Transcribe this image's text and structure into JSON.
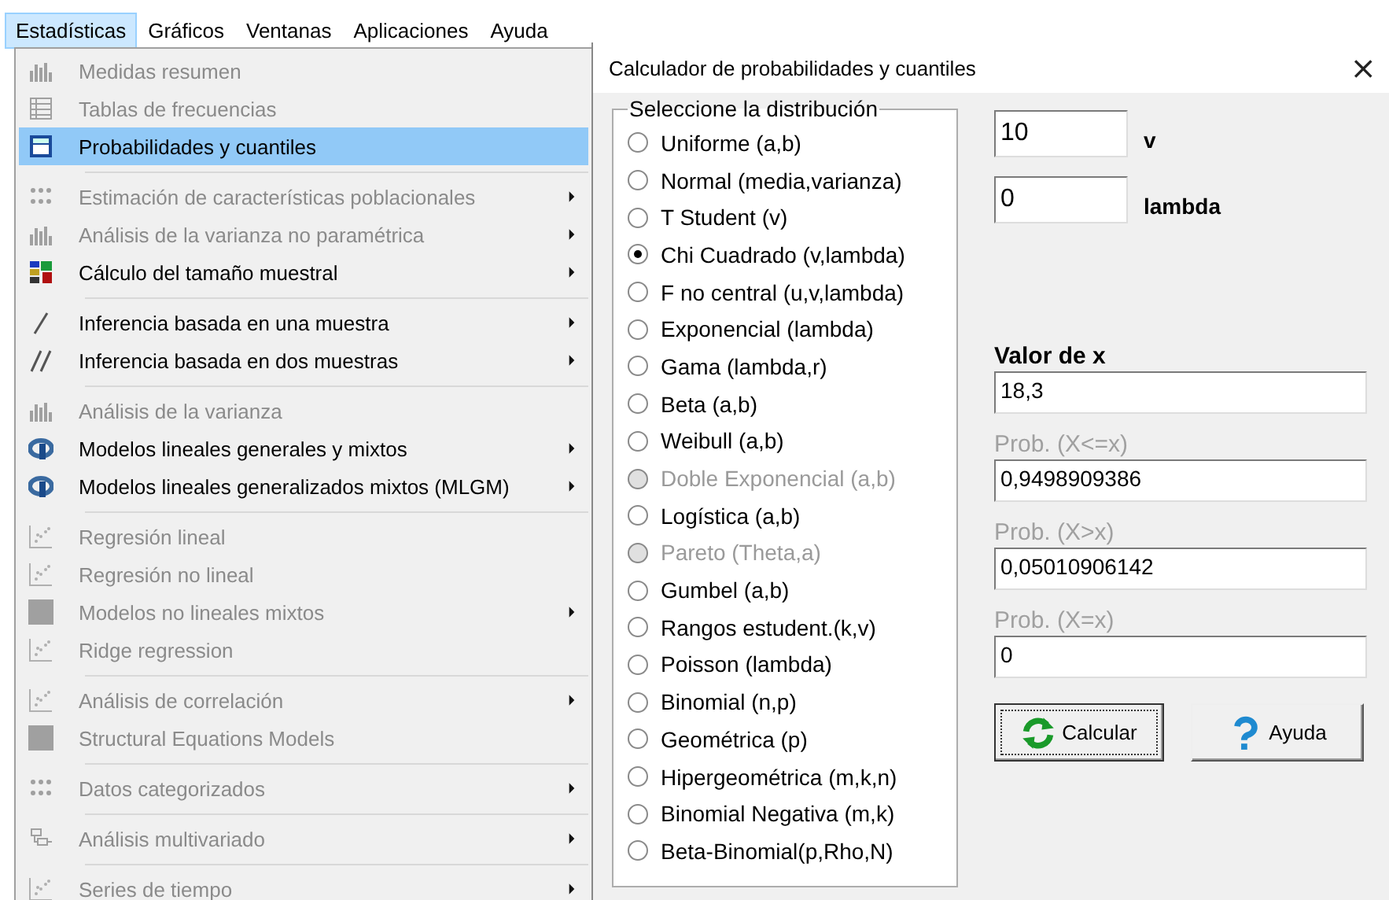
{
  "menu_bar": [
    {
      "label": "Estadísticas",
      "selected": true
    },
    {
      "label": "Gráficos",
      "selected": false
    },
    {
      "label": "Ventanas",
      "selected": false
    },
    {
      "label": "Aplicaciones",
      "selected": false
    },
    {
      "label": "Ayuda",
      "selected": false
    }
  ],
  "menu": {
    "groups": [
      {
        "items": [
          {
            "label": "Medidas resumen",
            "disabled": true,
            "submenu": false,
            "selected": false
          },
          {
            "label": "Tablas de frecuencias",
            "disabled": true,
            "submenu": false,
            "selected": false
          },
          {
            "label": "Probabilidades y cuantiles",
            "disabled": false,
            "submenu": false,
            "selected": true
          }
        ]
      },
      {
        "items": [
          {
            "label": "Estimación de características poblacionales",
            "disabled": true,
            "submenu": true,
            "selected": false
          },
          {
            "label": "Análisis de la varianza no paramétrica",
            "disabled": true,
            "submenu": true,
            "selected": false
          },
          {
            "label": "Cálculo del tamaño muestral",
            "disabled": false,
            "submenu": true,
            "selected": false
          }
        ]
      },
      {
        "items": [
          {
            "label": "Inferencia basada en una muestra",
            "disabled": false,
            "submenu": true,
            "selected": false
          },
          {
            "label": "Inferencia basada en dos muestras",
            "disabled": false,
            "submenu": true,
            "selected": false
          }
        ]
      },
      {
        "items": [
          {
            "label": "Análisis de la varianza",
            "disabled": true,
            "submenu": false,
            "selected": false
          },
          {
            "label": "Modelos lineales generales y mixtos",
            "disabled": false,
            "submenu": true,
            "selected": false
          },
          {
            "label": "Modelos lineales generalizados mixtos (MLGM)",
            "disabled": false,
            "submenu": true,
            "selected": false
          }
        ]
      },
      {
        "items": [
          {
            "label": "Regresión lineal",
            "disabled": true,
            "submenu": false,
            "selected": false
          },
          {
            "label": "Regresión no lineal",
            "disabled": true,
            "submenu": false,
            "selected": false
          },
          {
            "label": "Modelos no lineales mixtos",
            "disabled": true,
            "submenu": true,
            "selected": false
          },
          {
            "label": "Ridge regression",
            "disabled": true,
            "submenu": false,
            "selected": false
          }
        ]
      },
      {
        "items": [
          {
            "label": "Análisis de correlación",
            "disabled": true,
            "submenu": true,
            "selected": false
          },
          {
            "label": "Structural Equations Models",
            "disabled": true,
            "submenu": false,
            "selected": false
          }
        ]
      },
      {
        "items": [
          {
            "label": "Datos categorizados",
            "disabled": true,
            "submenu": true,
            "selected": false
          }
        ]
      },
      {
        "items": [
          {
            "label": "Análisis multivariado",
            "disabled": true,
            "submenu": true,
            "selected": false
          }
        ]
      },
      {
        "items": [
          {
            "label": "Series de tiempo",
            "disabled": true,
            "submenu": true,
            "selected": false
          }
        ]
      }
    ]
  },
  "dialog": {
    "title": "Calculador de probabilidades y cuantiles",
    "close": "×",
    "group_title": "Seleccione la distribución",
    "distributions": [
      {
        "label": "Uniforme (a,b)",
        "selected": false,
        "disabled": false
      },
      {
        "label": "Normal (media,varianza)",
        "selected": false,
        "disabled": false
      },
      {
        "label": "T Student (v)",
        "selected": false,
        "disabled": false
      },
      {
        "label": "Chi Cuadrado (v,lambda)",
        "selected": true,
        "disabled": false
      },
      {
        "label": "F no central (u,v,lambda)",
        "selected": false,
        "disabled": false
      },
      {
        "label": "Exponencial (lambda)",
        "selected": false,
        "disabled": false
      },
      {
        "label": "Gama (lambda,r)",
        "selected": false,
        "disabled": false
      },
      {
        "label": "Beta (a,b)",
        "selected": false,
        "disabled": false
      },
      {
        "label": "Weibull (a,b)",
        "selected": false,
        "disabled": false
      },
      {
        "label": "Doble Exponencial (a,b)",
        "selected": false,
        "disabled": true
      },
      {
        "label": "Logística (a,b)",
        "selected": false,
        "disabled": false
      },
      {
        "label": "Pareto (Theta,a)",
        "selected": false,
        "disabled": true
      },
      {
        "label": "Gumbel (a,b)",
        "selected": false,
        "disabled": false
      },
      {
        "label": "Rangos estudent.(k,v)",
        "selected": false,
        "disabled": false
      },
      {
        "label": "Poisson (lambda)",
        "selected": false,
        "disabled": false
      },
      {
        "label": "Binomial (n,p)",
        "selected": false,
        "disabled": false
      },
      {
        "label": "Geométrica (p)",
        "selected": false,
        "disabled": false
      },
      {
        "label": "Hipergeométrica (m,k,n)",
        "selected": false,
        "disabled": false
      },
      {
        "label": "Binomial Negativa (m,k)",
        "selected": false,
        "disabled": false
      },
      {
        "label": "Beta-Binomial(p,Rho,N)",
        "selected": false,
        "disabled": false
      }
    ],
    "parameters": [
      {
        "value": "10",
        "label": "v"
      },
      {
        "value": "0",
        "label": "lambda"
      }
    ],
    "results": [
      {
        "label": "Valor de x",
        "value": "18,3",
        "disabled": false
      },
      {
        "label": "Prob. (X<=x)",
        "value": "0,9498909386",
        "disabled": true
      },
      {
        "label": "Prob. (X>x)",
        "value": "0,05010906142",
        "disabled": true
      },
      {
        "label": "Prob. (X=x)",
        "value": "0",
        "disabled": true
      }
    ],
    "buttons": [
      {
        "kind": "calculate",
        "label": "Calcular",
        "focused": true
      },
      {
        "kind": "help",
        "label": "Ayuda",
        "focused": false
      }
    ]
  }
}
